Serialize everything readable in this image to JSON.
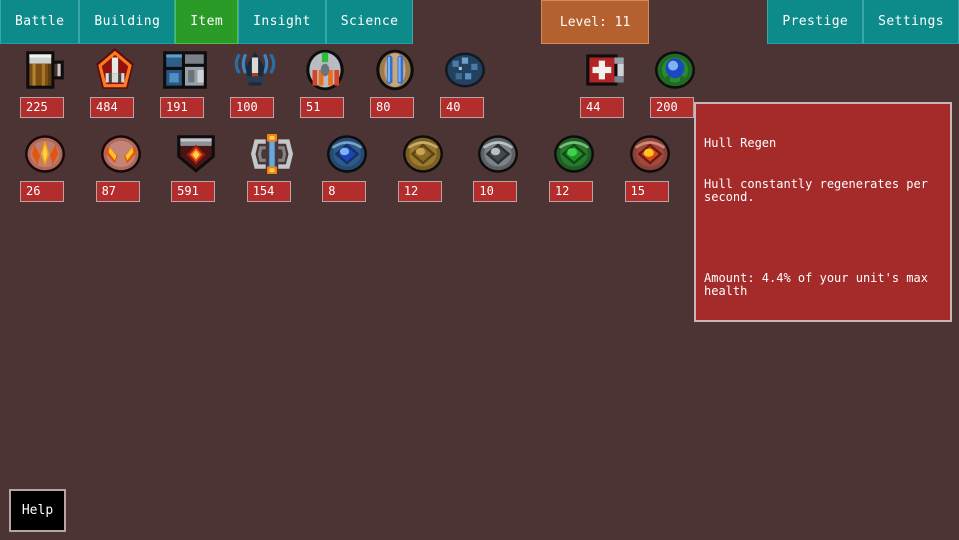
{
  "theme": {
    "background": "#4d3434",
    "tab_teal": "#0d8b8b",
    "tab_active_green": "#2b9b27",
    "level_orange": "#b5602f",
    "value_badge_red": "#b32d2d",
    "tooltip_red": "#a52a2a",
    "border_gray": "#b9a4a4"
  },
  "navbar": {
    "tabs": [
      {
        "label": "Battle",
        "name": "tab-battle",
        "active": false
      },
      {
        "label": "Building",
        "name": "tab-building",
        "active": false
      },
      {
        "label": "Item",
        "name": "tab-item",
        "active": true
      },
      {
        "label": "Insight",
        "name": "tab-insight",
        "active": false
      },
      {
        "label": "Science",
        "name": "tab-science",
        "active": false
      }
    ],
    "level_badge": "Level: 11",
    "right_tabs": [
      {
        "label": "Prestige",
        "name": "tab-prestige"
      },
      {
        "label": "Settings",
        "name": "tab-settings"
      }
    ]
  },
  "items": {
    "row1": [
      {
        "icon": "beer-mug-icon",
        "value": "225",
        "empty": false
      },
      {
        "icon": "red-crest-icon",
        "value": "484",
        "empty": false
      },
      {
        "icon": "blue-machine-icon",
        "value": "191",
        "empty": false
      },
      {
        "icon": "antenna-drone-icon",
        "value": "100",
        "empty": false
      },
      {
        "icon": "silver-thruster-icon",
        "value": "51",
        "empty": false
      },
      {
        "icon": "blue-bars-icon",
        "value": "80",
        "empty": false
      },
      {
        "icon": "blue-asteroid-icon",
        "value": "40",
        "empty": false
      },
      {
        "icon": "empty-slot-icon",
        "value": "",
        "empty": true
      },
      {
        "icon": "medkit-icon",
        "value": "44",
        "empty": false
      },
      {
        "icon": "green-orb-shield-icon",
        "value": "200",
        "empty": false
      }
    ],
    "row2": [
      {
        "icon": "red-claw-orb-icon",
        "value": "26",
        "empty": false
      },
      {
        "icon": "red-fang-orb-icon",
        "value": "87",
        "empty": false
      },
      {
        "icon": "red-gem-shield-icon",
        "value": "591",
        "empty": false
      },
      {
        "icon": "reactor-coil-icon",
        "value": "154",
        "empty": false
      },
      {
        "icon": "blue-gem-disc-icon",
        "value": "8",
        "empty": false
      },
      {
        "icon": "gold-gem-disc-icon",
        "value": "12",
        "empty": false
      },
      {
        "icon": "silver-gem-disc-icon",
        "value": "10",
        "empty": false
      },
      {
        "icon": "green-gem-disc-icon",
        "value": "12",
        "empty": false
      },
      {
        "icon": "red-gem-disc-icon",
        "value": "15",
        "empty": false
      }
    ]
  },
  "tooltip": {
    "title": "Hull Regen",
    "description": "Hull constantly regenerates per second.",
    "amount": "Amount: 4.4% of your unit's max health"
  },
  "help": {
    "label": "Help"
  }
}
